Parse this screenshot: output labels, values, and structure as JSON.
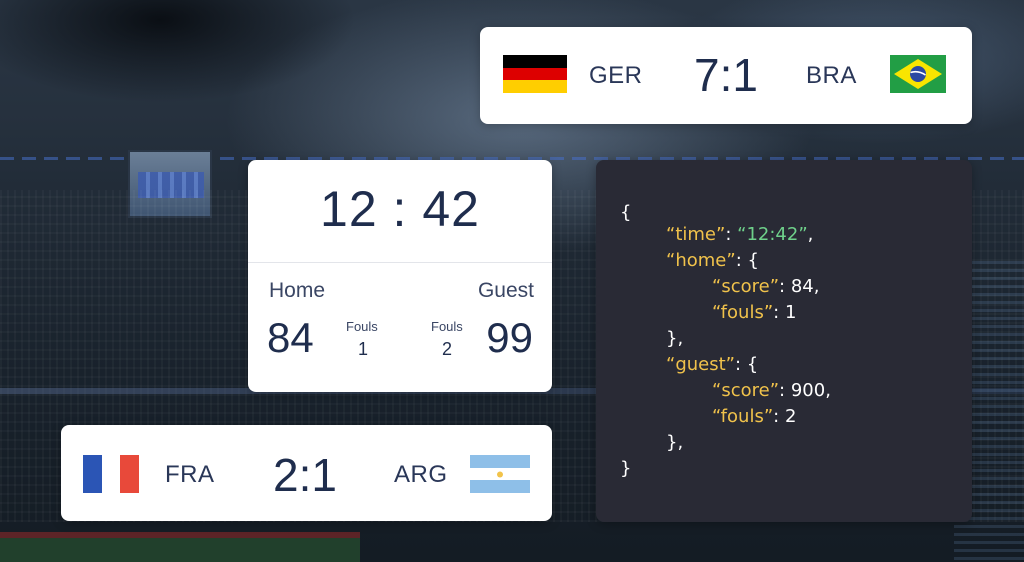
{
  "matches": {
    "top": {
      "home_team": "GER",
      "score": "7:1",
      "guest_team": "BRA",
      "home_flag_icon": "germany-flag",
      "guest_flag_icon": "brazil-flag"
    },
    "bottom": {
      "home_team": "FRA",
      "score": "2:1",
      "guest_team": "ARG",
      "home_flag_icon": "france-flag",
      "guest_flag_icon": "argentina-flag"
    }
  },
  "scoreboard": {
    "time": "12 : 42",
    "home_label": "Home",
    "guest_label": "Guest",
    "home_score": "84",
    "guest_score": "99",
    "fouls_label": "Fouls",
    "home_fouls": "1",
    "guest_fouls": "2"
  },
  "code": {
    "open_brace": "{",
    "time_key": "“time”",
    "time_value": "“12:42”",
    "home_key": "“home”",
    "score_key": "“score”",
    "fouls_key": "“fouls”",
    "guest_key": "“guest”",
    "home_score_value": "84",
    "home_fouls_value": "1",
    "guest_score_value": "900",
    "guest_fouls_value": "2",
    "close_inner": "},",
    "close_brace": "}"
  },
  "colors": {
    "card_text": "#1f2d4d",
    "code_bg": "#292a35",
    "code_key": "#f0c24b",
    "code_string": "#6fd18b"
  }
}
